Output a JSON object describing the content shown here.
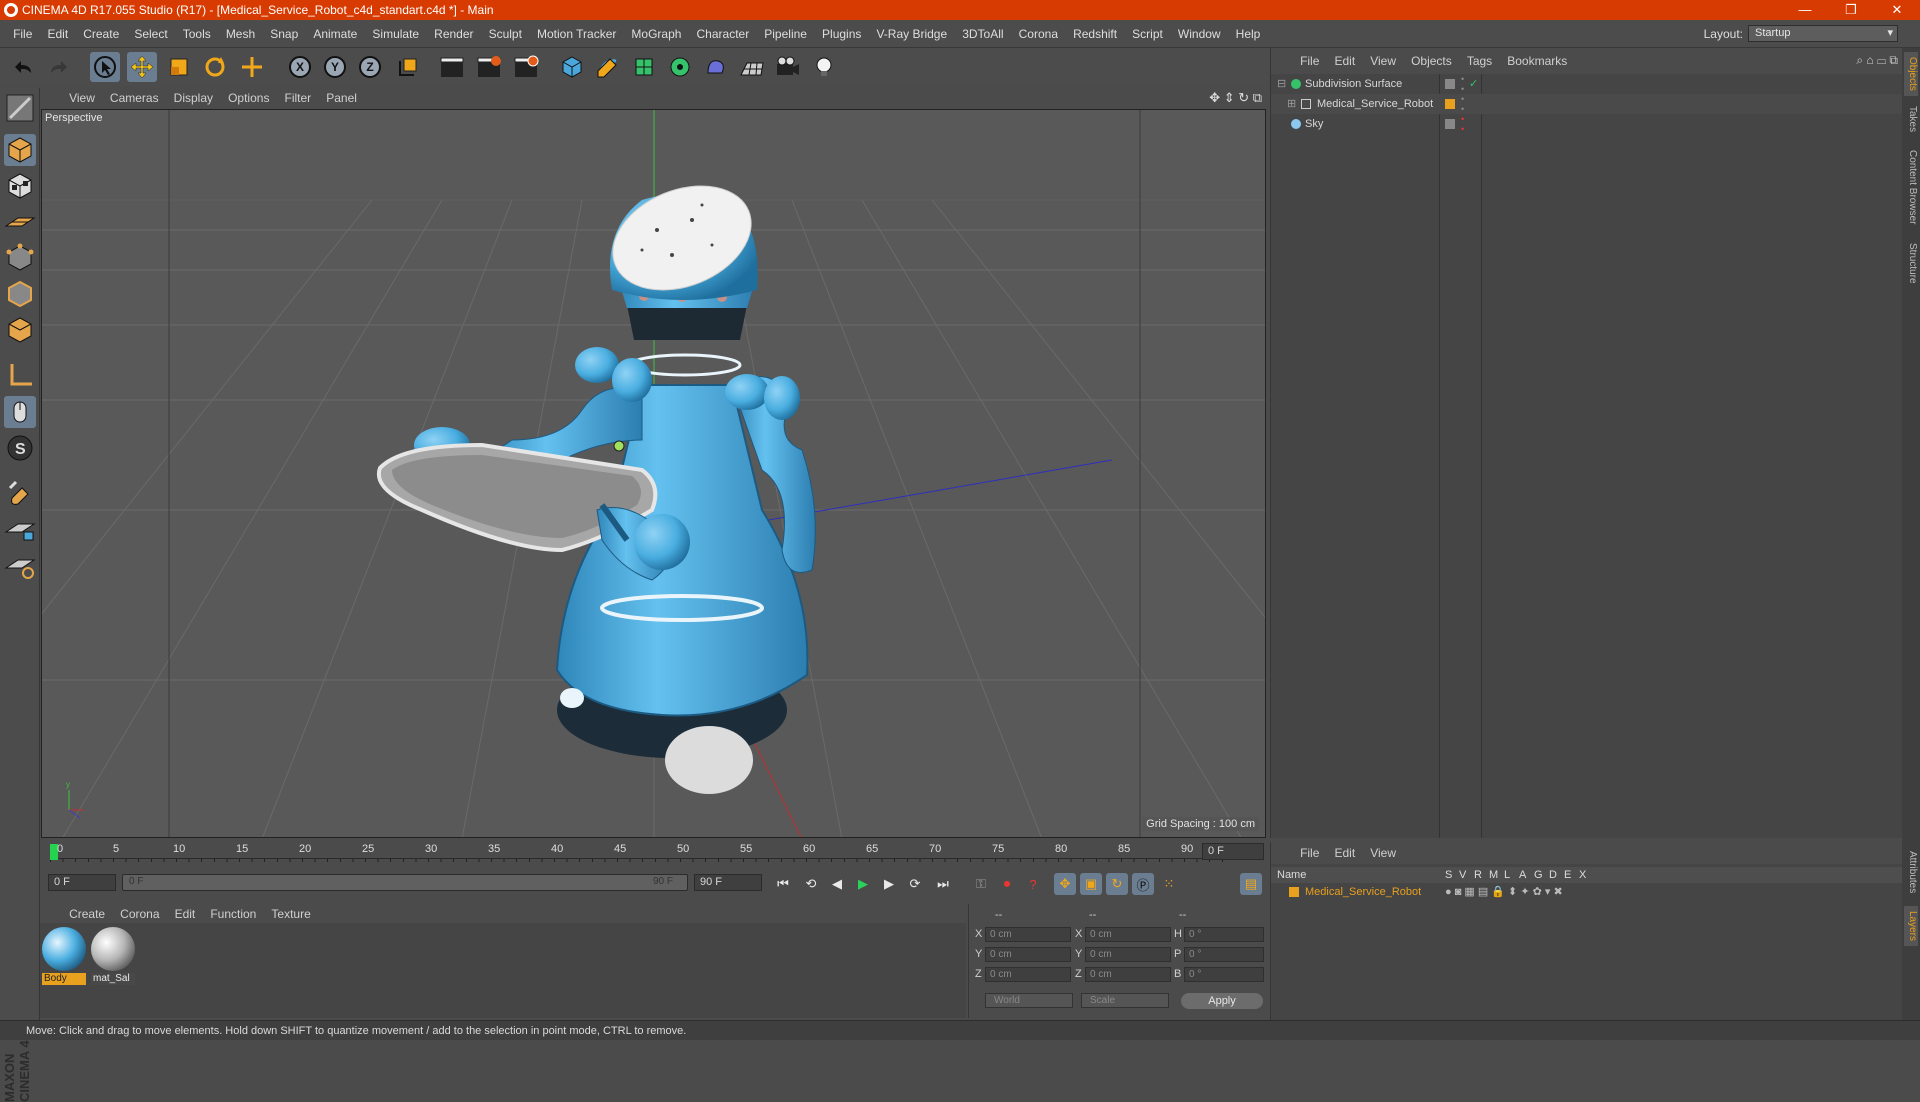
{
  "window": {
    "title": "CINEMA 4D R17.055 Studio (R17) - [Medical_Service_Robot_c4d_standart.c4d *] - Main",
    "minimize": "—",
    "restore": "❐",
    "close": "✕"
  },
  "menubar": {
    "items": [
      "File",
      "Edit",
      "Create",
      "Select",
      "Tools",
      "Mesh",
      "Snap",
      "Animate",
      "Simulate",
      "Render",
      "Sculpt",
      "Motion Tracker",
      "MoGraph",
      "Character",
      "Pipeline",
      "Plugins",
      "V-Ray Bridge",
      "3DToAll",
      "Corona",
      "Redshift",
      "Script",
      "Window",
      "Help"
    ],
    "layout_label": "Layout:",
    "layout_value": "Startup"
  },
  "toolbar": {
    "x_label": "X",
    "y_label": "Y",
    "z_label": "Z"
  },
  "viewport": {
    "menu": [
      "View",
      "Cameras",
      "Display",
      "Options",
      "Filter",
      "Panel"
    ],
    "label": "Perspective",
    "grid_spacing": "Grid Spacing : 100 cm"
  },
  "timeline": {
    "ticks": [
      "0",
      "5",
      "10",
      "15",
      "20",
      "25",
      "30",
      "35",
      "40",
      "45",
      "50",
      "55",
      "60",
      "65",
      "70",
      "75",
      "80",
      "85",
      "90"
    ],
    "current_frame": "0 F",
    "start_frame": "0 F",
    "range_start": "0 F",
    "range_end": "90 F",
    "end_frame": "90 F"
  },
  "materials": {
    "menu": [
      "Create",
      "Corona",
      "Edit",
      "Function",
      "Texture"
    ],
    "items": [
      {
        "label": "Body"
      },
      {
        "label": "mat_Sal"
      }
    ]
  },
  "coordinates": {
    "headers": [
      "--",
      "--",
      "--"
    ],
    "rows": [
      {
        "axis": "X",
        "pos": "0 cm",
        "axis2": "X",
        "size": "0 cm",
        "rot_axis": "H",
        "rot": "0 °"
      },
      {
        "axis": "Y",
        "pos": "0 cm",
        "axis2": "Y",
        "size": "0 cm",
        "rot_axis": "P",
        "rot": "0 °"
      },
      {
        "axis": "Z",
        "pos": "0 cm",
        "axis2": "Z",
        "size": "0 cm",
        "rot_axis": "B",
        "rot": "0 °"
      }
    ],
    "world": "World",
    "scale": "Scale",
    "apply": "Apply"
  },
  "status": "Move: Click and drag to move elements. Hold down SHIFT to quantize movement / add to the selection in point mode, CTRL to remove.",
  "object_manager": {
    "menu": [
      "File",
      "Edit",
      "View",
      "Objects",
      "Tags",
      "Bookmarks"
    ],
    "objects": [
      {
        "name": "Subdivision Surface"
      },
      {
        "name": "Medical_Service_Robot"
      },
      {
        "name": "Sky"
      }
    ]
  },
  "layer_manager": {
    "menu": [
      "File",
      "Edit",
      "View"
    ],
    "name_header": "Name",
    "columns": [
      "S",
      "V",
      "R",
      "M",
      "L",
      "A",
      "G",
      "D",
      "E",
      "X"
    ],
    "layer": "Medical_Service_Robot"
  },
  "side_tabs": {
    "top": [
      "Objects",
      "Takes",
      "Content Browser",
      "Structure"
    ],
    "bottom": [
      "Attributes",
      "Layers"
    ]
  },
  "logo": {
    "text1": "MAXON",
    "text2": "CINEMA 4D"
  },
  "colors": {
    "accent": "#d83b01",
    "highlight": "#e8a01f",
    "robot_blue": "#4aaee0"
  }
}
